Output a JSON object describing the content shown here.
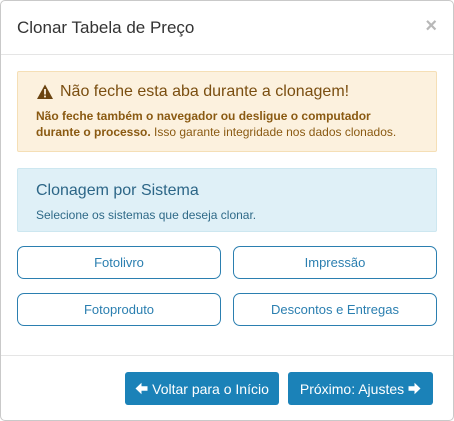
{
  "modal": {
    "title": "Clonar Tabela de Preço",
    "close_symbol": "×"
  },
  "warning": {
    "icon": "warning-triangle-icon",
    "title": "Não feche esta aba durante a clonagem!",
    "bold_text": "Não feche também o navegador ou desligue o computador durante o processo.",
    "normal_text": " Isso garante integridade nos dados clonados."
  },
  "info": {
    "title": "Clonagem por Sistema",
    "text": "Selecione os sistemas que deseja clonar."
  },
  "systems": [
    "Fotolivro",
    "Impressão",
    "Fotoproduto",
    "Descontos e Entregas"
  ],
  "footer": {
    "back_label": "Voltar para o Início",
    "next_label": "Próximo: Ajustes"
  },
  "colors": {
    "primary": "#1b82b8",
    "outline": "#2b7fb0",
    "warning_bg": "#fcf1de",
    "info_bg": "#dff0f7"
  }
}
